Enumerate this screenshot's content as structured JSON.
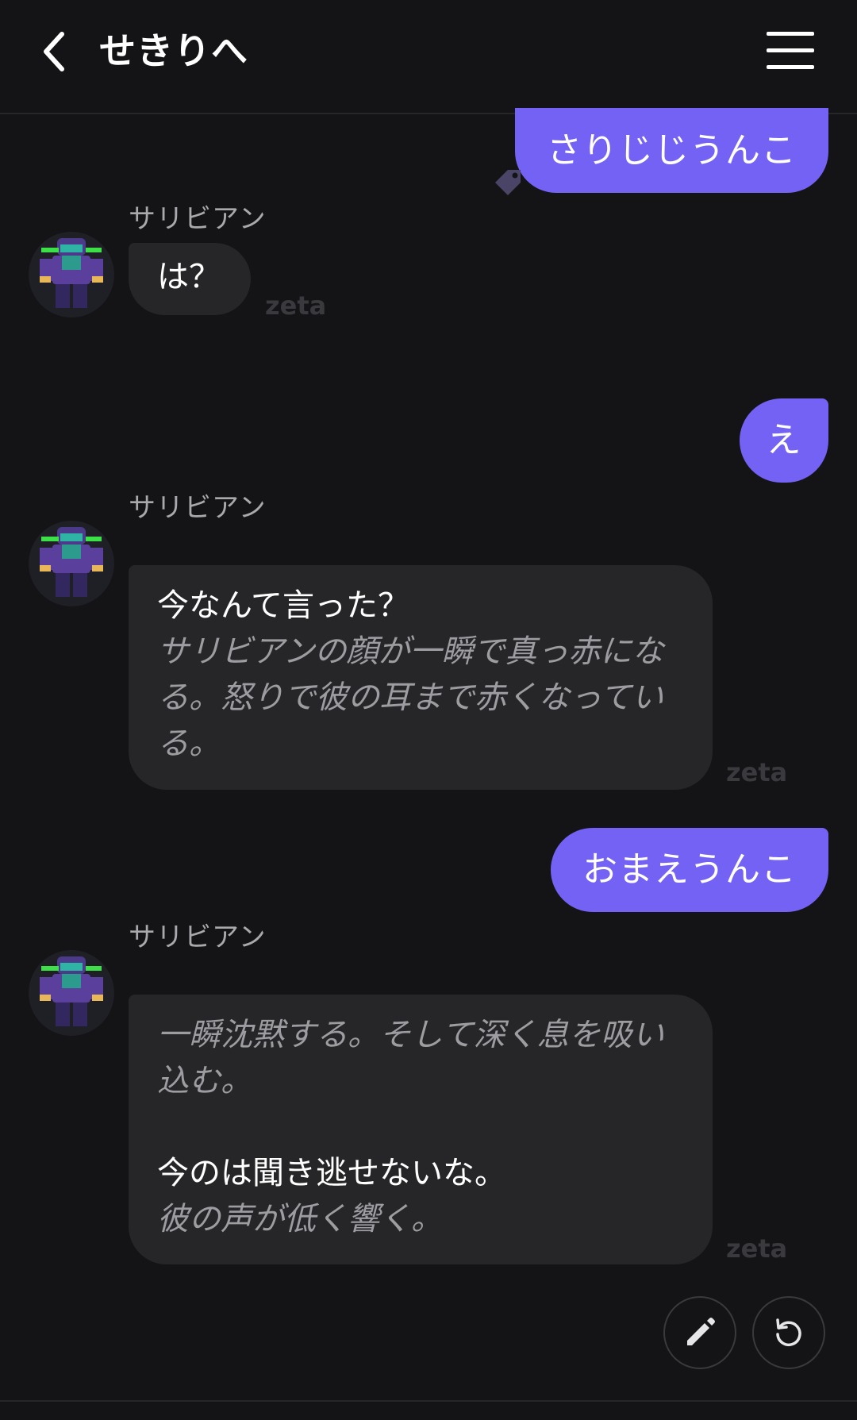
{
  "header": {
    "title": "せきりへ",
    "back_icon": "chevron-left-icon",
    "menu_icon": "hamburger-menu-icon"
  },
  "messages": [
    {
      "role": "user",
      "text": "さりじじうんこ"
    },
    {
      "role": "character",
      "name": "サリビアン",
      "dialogue": "は？",
      "watermark": "zeta"
    },
    {
      "role": "user",
      "text": "え"
    },
    {
      "role": "character",
      "name": "サリビアン",
      "dialogue": "今なんて言った？",
      "action": "サリビアンの顔が一瞬で真っ赤になる。怒りで彼の耳まで赤くなっている。",
      "watermark": "zeta"
    },
    {
      "role": "user",
      "text": "おまえうんこ"
    },
    {
      "role": "character",
      "name": "サリビアン",
      "action_first": "一瞬沈黙する。そして深く息を吸い込む。",
      "dialogue": "今のは聞き逃せないな。",
      "action_last": "彼の声が低く響く。",
      "watermark": "zeta"
    }
  ],
  "actions": {
    "edit_icon": "pencil-icon",
    "regenerate_icon": "refresh-icon"
  },
  "colors": {
    "background": "#141416",
    "user_bubble": "#7462f5",
    "bot_bubble": "#262628",
    "action_text": "#9c9ca1",
    "name_text": "#a9a9ad"
  }
}
